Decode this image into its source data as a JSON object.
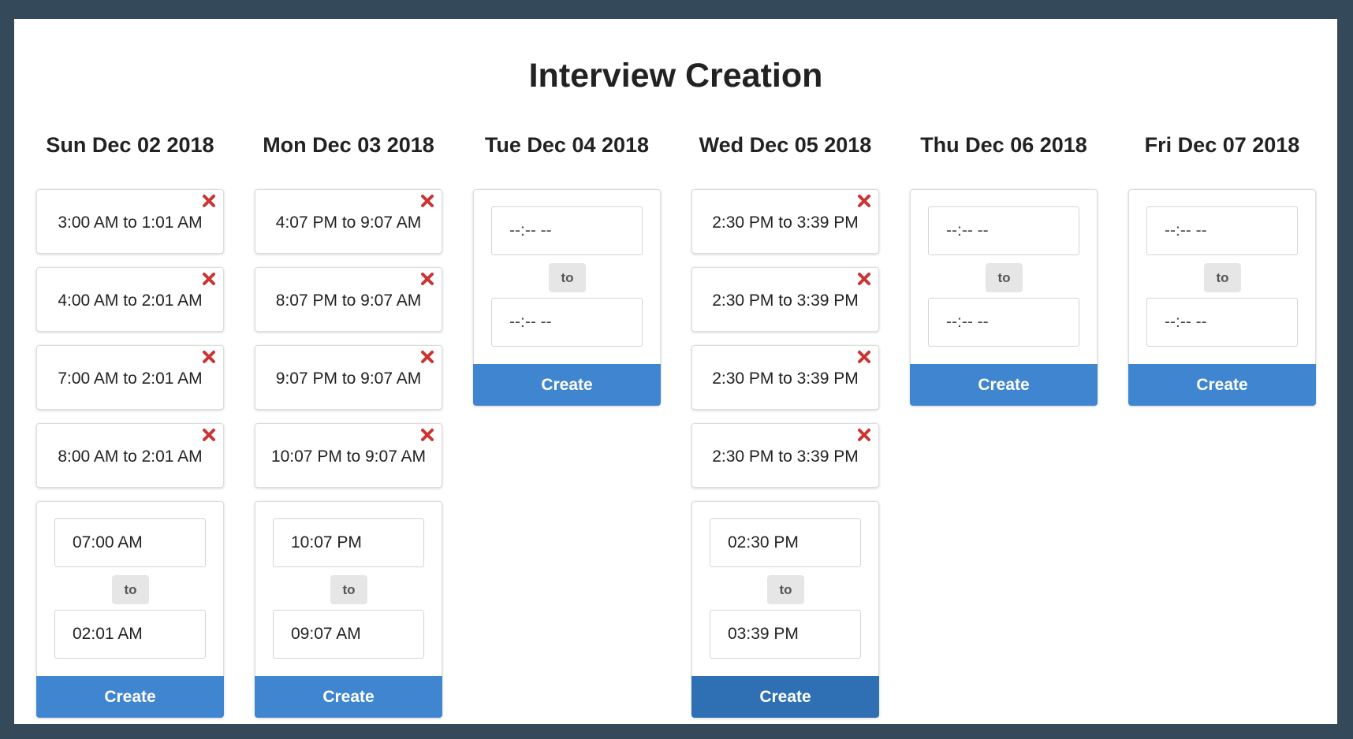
{
  "page": {
    "title": "Interview Creation"
  },
  "colors": {
    "background": "#34495a",
    "create_button": "#3f85cf",
    "create_button_active": "#2f6fb4",
    "delete_icon": "#cc3333"
  },
  "days": [
    {
      "header": "Sun Dec 02 2018",
      "slots": [
        {
          "label": "3:00 AM to 1:01 AM"
        },
        {
          "label": "4:00 AM to 2:01 AM"
        },
        {
          "label": "7:00 AM to 2:01 AM"
        },
        {
          "label": "8:00 AM to 2:01 AM"
        }
      ],
      "form": {
        "from_value": "07:00 AM",
        "to_value": "02:01 AM",
        "to_label": "to",
        "create_label": "Create",
        "active": false
      }
    },
    {
      "header": "Mon Dec 03 2018",
      "slots": [
        {
          "label": "4:07 PM to 9:07 AM"
        },
        {
          "label": "8:07 PM to 9:07 AM"
        },
        {
          "label": "9:07 PM to 9:07 AM"
        },
        {
          "label": "10:07 PM to 9:07 AM"
        }
      ],
      "form": {
        "from_value": "10:07 PM",
        "to_value": "09:07 AM",
        "to_label": "to",
        "create_label": "Create",
        "active": false
      }
    },
    {
      "header": "Tue Dec 04 2018",
      "slots": [],
      "form": {
        "from_value": "--:-- --",
        "to_value": "--:-- --",
        "to_label": "to",
        "create_label": "Create",
        "active": false
      }
    },
    {
      "header": "Wed Dec 05 2018",
      "slots": [
        {
          "label": "2:30 PM to 3:39 PM"
        },
        {
          "label": "2:30 PM to 3:39 PM"
        },
        {
          "label": "2:30 PM to 3:39 PM"
        },
        {
          "label": "2:30 PM to 3:39 PM"
        }
      ],
      "form": {
        "from_value": "02:30 PM",
        "to_value": "03:39 PM",
        "to_label": "to",
        "create_label": "Create",
        "active": true
      }
    },
    {
      "header": "Thu Dec 06 2018",
      "slots": [],
      "form": {
        "from_value": "--:-- --",
        "to_value": "--:-- --",
        "to_label": "to",
        "create_label": "Create",
        "active": false
      }
    },
    {
      "header": "Fri Dec 07 2018",
      "slots": [],
      "form": {
        "from_value": "--:-- --",
        "to_value": "--:-- --",
        "to_label": "to",
        "create_label": "Create",
        "active": false
      }
    }
  ]
}
